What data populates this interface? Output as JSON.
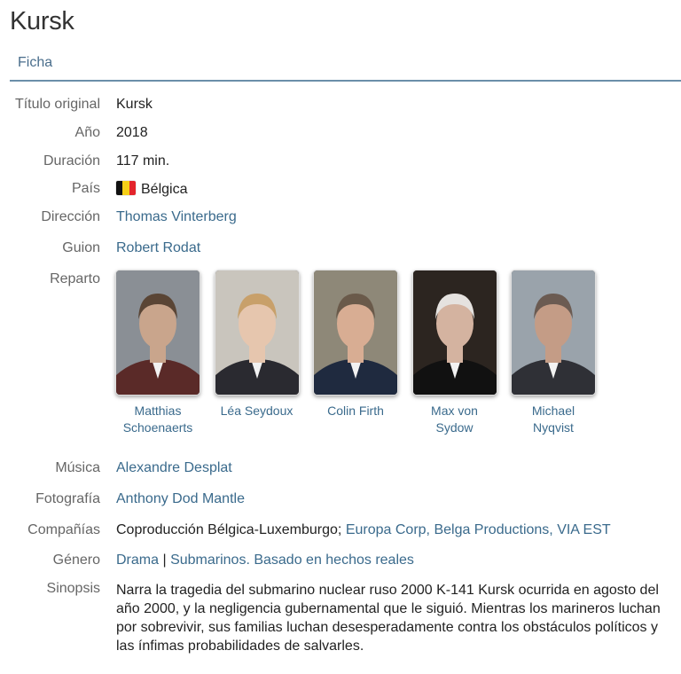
{
  "page": {
    "title": "Kursk"
  },
  "tabs": [
    {
      "label": "Ficha"
    }
  ],
  "fields": {
    "titulo_original": {
      "label": "Título original",
      "value": "Kursk"
    },
    "anio": {
      "label": "Año",
      "value": "2018"
    },
    "duracion": {
      "label": "Duración",
      "value": "117 min."
    },
    "pais": {
      "label": "País",
      "value": "Bélgica",
      "flag": "belgium-flag",
      "flag_colors": [
        "#111111",
        "#f5cf17",
        "#e3242b"
      ]
    },
    "direccion": {
      "label": "Dirección",
      "value": "Thomas Vinterberg"
    },
    "guion": {
      "label": "Guion",
      "value": "Robert Rodat"
    },
    "reparto": {
      "label": "Reparto"
    },
    "musica": {
      "label": "Música",
      "value": "Alexandre Desplat"
    },
    "fotografia": {
      "label": "Fotografía",
      "value": "Anthony Dod Mantle"
    },
    "companias": {
      "label": "Compañías",
      "prefix": "Coproducción Bélgica-Luxemburgo;",
      "links": [
        "Europa Corp",
        "Belga Productions",
        "VIA EST"
      ]
    },
    "genero": {
      "label": "Género",
      "links": [
        "Drama",
        "Submarinos",
        "Basado en hechos reales"
      ]
    },
    "sinopsis": {
      "label": "Sinopsis",
      "text": "Narra la tragedia del submarino nuclear ruso 2000 K-141 Kursk ocurrida en agosto del año 2000, y la negligencia gubernamental que le siguió. Mientras los marineros luchan por sobrevivir, sus familias luchan desesperadamente contra los obstáculos políticos y las ínfimas probabilidades de salvarles."
    }
  },
  "cast": [
    {
      "name_line1": "Matthias",
      "name_line2": "Schoenaerts",
      "bg": "#8a8f95",
      "skin": "#c9a58c",
      "hair": "#5a4535",
      "suit": "#5a2a28"
    },
    {
      "name_line1": "Léa Seydoux",
      "name_line2": "",
      "bg": "#c9c5bd",
      "skin": "#e6c6ae",
      "hair": "#c8a06a",
      "suit": "#2a2a30"
    },
    {
      "name_line1": "Colin Firth",
      "name_line2": "",
      "bg": "#8e8878",
      "skin": "#d8ad93",
      "hair": "#6a5a4a",
      "suit": "#1f2a3f"
    },
    {
      "name_line1": "Max von",
      "name_line2": "Sydow",
      "bg": "#2c2520",
      "skin": "#d4b3a0",
      "hair": "#e5e2df",
      "suit": "#111111"
    },
    {
      "name_line1": "Michael",
      "name_line2": "Nyqvist",
      "bg": "#9aa3ab",
      "skin": "#c49c86",
      "hair": "#6b5b52",
      "suit": "#2f3036"
    }
  ]
}
